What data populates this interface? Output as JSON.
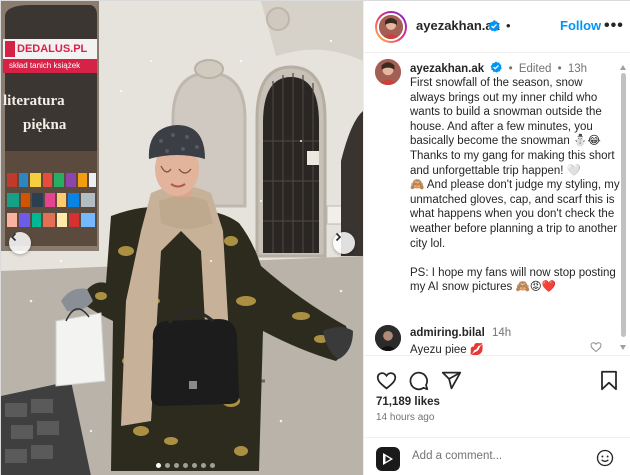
{
  "post": {
    "photo": {
      "shop_sign": "DEDALUS.PL",
      "shop_subsign": "skład tanich książek",
      "window_text_line1": "literatura",
      "window_text_line2": "piękna",
      "total_images": 7,
      "current_image": 1
    },
    "header": {
      "username": "ayezakhan.ak",
      "follow_label": "Follow",
      "more_label": "•••"
    },
    "caption": {
      "username": "ayezakhan.ak",
      "edited_label": "Edited",
      "separator": "•",
      "time": "13h",
      "paragraph1": "First snowfall of the season, snow always brings out my inner child who wants to build a snowman outside the house. And after a few minutes, you basically become the snowman ⛄😂",
      "paragraph2": "Thanks to my gang for making this short and unforgettable trip happen! 🤍",
      "paragraph3": "🙈 And please don't judge my styling, my unmatched gloves, cap, and scarf this is what happens when you don't check the weather before planning a trip to another city lol.",
      "paragraph4": "PS: I hope my fans will now stop posting my AI snow pictures 🙈😡❤️"
    },
    "comment": {
      "username": "admiring.bilal",
      "time": "14h",
      "text": "Ayezu piee 💋"
    },
    "stats": {
      "likes": "71,189 likes",
      "posted": "14 hours ago"
    },
    "add_comment": {
      "placeholder": "Add a comment..."
    },
    "colors": {
      "accent_blue": "#0095f6",
      "text_primary": "#262626",
      "text_secondary": "#737373",
      "verified_blue": "#0095f6"
    }
  }
}
